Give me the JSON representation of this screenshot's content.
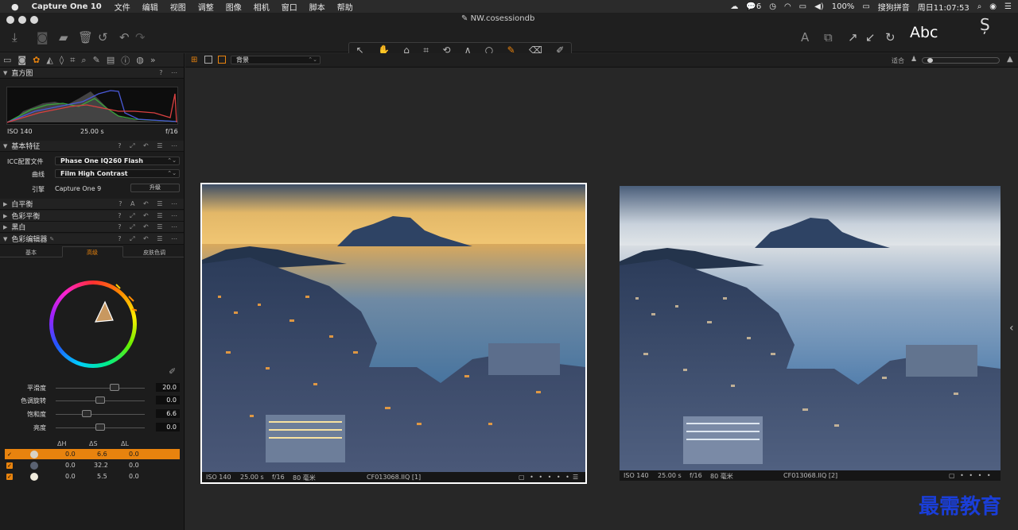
{
  "menubar": {
    "app_name": "Capture One 10",
    "menus": [
      "文件",
      "编辑",
      "视图",
      "调整",
      "图像",
      "相机",
      "窗口",
      "脚本",
      "帮助"
    ],
    "status": {
      "wechat_count": "6",
      "battery": "100%",
      "input_method": "搜狗拼音",
      "datetime": "周日11:07:53"
    }
  },
  "window": {
    "title": "NW.cosessiondb",
    "abc_label": "Abc"
  },
  "left_panel": {
    "histogram": {
      "title": "直方图",
      "iso": "ISO 140",
      "shutter": "25.00 s",
      "aperture": "f/16"
    },
    "basic": {
      "title": "基本特征",
      "icc_label": "ICC配置文件",
      "icc_value": "Phase One IQ260 Flash",
      "curve_label": "曲线",
      "curve_value": "Film High Contrast",
      "engine_label": "引擎",
      "engine_value": "Capture One 9",
      "upgrade_button": "升级"
    },
    "sections": [
      "白平衡",
      "色彩平衡",
      "黑白"
    ],
    "color_editor": {
      "title": "色彩编辑器",
      "tabs": [
        "基本",
        "高级",
        "皮肤色调"
      ],
      "sliders": [
        {
          "label": "平滑度",
          "value": "20.0"
        },
        {
          "label": "色调旋转",
          "value": "0.0"
        },
        {
          "label": "饱和度",
          "value": "6.6"
        },
        {
          "label": "亮度",
          "value": "0.0"
        }
      ],
      "table_headers": [
        "ΔH",
        "ΔS",
        "ΔL"
      ],
      "rows": [
        {
          "h": "0.0",
          "s": "6.6",
          "l": "0.0",
          "color": "#d8d2c4"
        },
        {
          "h": "0.0",
          "s": "32.2",
          "l": "0.0",
          "color": "#5a6272"
        },
        {
          "h": "0.0",
          "s": "5.5",
          "l": "0.0",
          "color": "#f0ebdc"
        }
      ]
    }
  },
  "viewer": {
    "background_select": "背景",
    "fit_label": "适合",
    "left_photo": {
      "iso": "ISO 140",
      "shutter": "25.00 s",
      "aperture": "f/16",
      "focal": "80 毫米",
      "filename": "CF013068.IIQ [1]"
    },
    "right_photo": {
      "iso": "ISO 140",
      "shutter": "25.00 s",
      "aperture": "f/16",
      "focal": "80 毫米",
      "filename": "CF013068.IIQ [2]"
    }
  },
  "watermark": "最需教育",
  "colors": {
    "accent": "#e8830e",
    "panel": "#1c1c1c",
    "viewer": "#272727"
  }
}
